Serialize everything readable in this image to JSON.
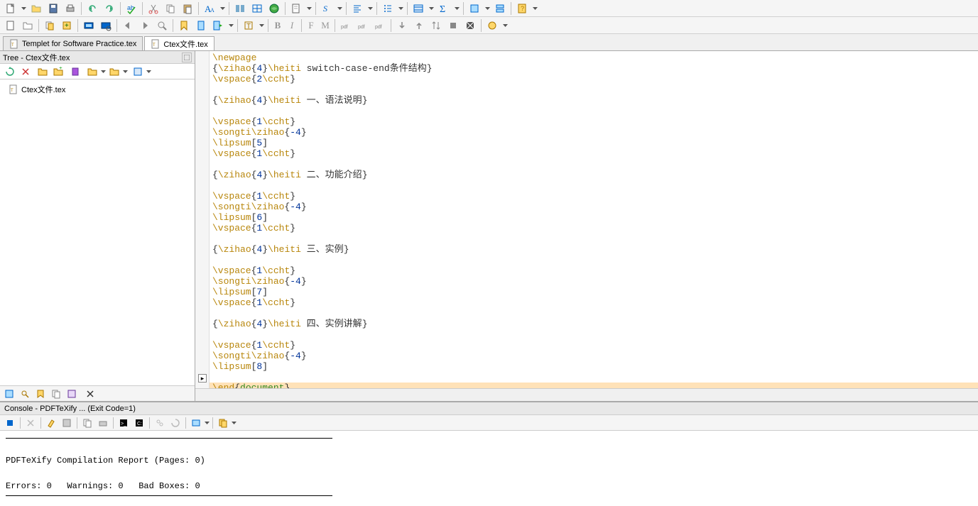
{
  "doctabs": [
    {
      "label": "Templet for Software Practice.tex",
      "active": false
    },
    {
      "label": "Ctex文件.tex",
      "active": true
    }
  ],
  "tree": {
    "title": "Tree - Ctex文件.tex",
    "items": [
      {
        "label": "Ctex文件.tex"
      }
    ]
  },
  "editor": {
    "highlighted_index": 31,
    "lines": [
      {
        "tokens": [
          [
            "cmd",
            "\\newpage"
          ]
        ]
      },
      {
        "tokens": [
          [
            "brace",
            "{"
          ],
          [
            "cmd",
            "\\zihao"
          ],
          [
            "brace",
            "{"
          ],
          [
            "num",
            "4"
          ],
          [
            "brace",
            "}"
          ],
          [
            "cmd",
            "\\heiti"
          ],
          [
            "txt",
            " switch-case-end条件结构"
          ],
          [
            "brace",
            "}"
          ]
        ]
      },
      {
        "tokens": [
          [
            "cmd",
            "\\vspace"
          ],
          [
            "brace",
            "{"
          ],
          [
            "num",
            "2"
          ],
          [
            "cmd",
            "\\ccht"
          ],
          [
            "brace",
            "}"
          ]
        ]
      },
      {
        "tokens": []
      },
      {
        "tokens": [
          [
            "brace",
            "{"
          ],
          [
            "cmd",
            "\\zihao"
          ],
          [
            "brace",
            "{"
          ],
          [
            "num",
            "4"
          ],
          [
            "brace",
            "}"
          ],
          [
            "cmd",
            "\\heiti"
          ],
          [
            "txt",
            " 一、语法说明"
          ],
          [
            "brace",
            "}"
          ]
        ]
      },
      {
        "tokens": []
      },
      {
        "tokens": [
          [
            "cmd",
            "\\vspace"
          ],
          [
            "brace",
            "{"
          ],
          [
            "num",
            "1"
          ],
          [
            "cmd",
            "\\ccht"
          ],
          [
            "brace",
            "}"
          ]
        ]
      },
      {
        "tokens": [
          [
            "cmd",
            "\\songti"
          ],
          [
            "cmd",
            "\\zihao"
          ],
          [
            "brace",
            "{"
          ],
          [
            "num",
            "-4"
          ],
          [
            "brace",
            "}"
          ]
        ]
      },
      {
        "tokens": [
          [
            "cmd",
            "\\lipsum"
          ],
          [
            "brace",
            "["
          ],
          [
            "num",
            "5"
          ],
          [
            "brace",
            "]"
          ]
        ]
      },
      {
        "tokens": [
          [
            "cmd",
            "\\vspace"
          ],
          [
            "brace",
            "{"
          ],
          [
            "num",
            "1"
          ],
          [
            "cmd",
            "\\ccht"
          ],
          [
            "brace",
            "}"
          ]
        ]
      },
      {
        "tokens": []
      },
      {
        "tokens": [
          [
            "brace",
            "{"
          ],
          [
            "cmd",
            "\\zihao"
          ],
          [
            "brace",
            "{"
          ],
          [
            "num",
            "4"
          ],
          [
            "brace",
            "}"
          ],
          [
            "cmd",
            "\\heiti"
          ],
          [
            "txt",
            " 二、功能介绍"
          ],
          [
            "brace",
            "}"
          ]
        ]
      },
      {
        "tokens": []
      },
      {
        "tokens": [
          [
            "cmd",
            "\\vspace"
          ],
          [
            "brace",
            "{"
          ],
          [
            "num",
            "1"
          ],
          [
            "cmd",
            "\\ccht"
          ],
          [
            "brace",
            "}"
          ]
        ]
      },
      {
        "tokens": [
          [
            "cmd",
            "\\songti"
          ],
          [
            "cmd",
            "\\zihao"
          ],
          [
            "brace",
            "{"
          ],
          [
            "num",
            "-4"
          ],
          [
            "brace",
            "}"
          ]
        ]
      },
      {
        "tokens": [
          [
            "cmd",
            "\\lipsum"
          ],
          [
            "brace",
            "["
          ],
          [
            "num",
            "6"
          ],
          [
            "brace",
            "]"
          ]
        ]
      },
      {
        "tokens": [
          [
            "cmd",
            "\\vspace"
          ],
          [
            "brace",
            "{"
          ],
          [
            "num",
            "1"
          ],
          [
            "cmd",
            "\\ccht"
          ],
          [
            "brace",
            "}"
          ]
        ]
      },
      {
        "tokens": []
      },
      {
        "tokens": [
          [
            "brace",
            "{"
          ],
          [
            "cmd",
            "\\zihao"
          ],
          [
            "brace",
            "{"
          ],
          [
            "num",
            "4"
          ],
          [
            "brace",
            "}"
          ],
          [
            "cmd",
            "\\heiti"
          ],
          [
            "txt",
            " 三、实例"
          ],
          [
            "brace",
            "}"
          ]
        ]
      },
      {
        "tokens": []
      },
      {
        "tokens": [
          [
            "cmd",
            "\\vspace"
          ],
          [
            "brace",
            "{"
          ],
          [
            "num",
            "1"
          ],
          [
            "cmd",
            "\\ccht"
          ],
          [
            "brace",
            "}"
          ]
        ]
      },
      {
        "tokens": [
          [
            "cmd",
            "\\songti"
          ],
          [
            "cmd",
            "\\zihao"
          ],
          [
            "brace",
            "{"
          ],
          [
            "num",
            "-4"
          ],
          [
            "brace",
            "}"
          ]
        ]
      },
      {
        "tokens": [
          [
            "cmd",
            "\\lipsum"
          ],
          [
            "brace",
            "["
          ],
          [
            "num",
            "7"
          ],
          [
            "brace",
            "]"
          ]
        ]
      },
      {
        "tokens": [
          [
            "cmd",
            "\\vspace"
          ],
          [
            "brace",
            "{"
          ],
          [
            "num",
            "1"
          ],
          [
            "cmd",
            "\\ccht"
          ],
          [
            "brace",
            "}"
          ]
        ]
      },
      {
        "tokens": []
      },
      {
        "tokens": [
          [
            "brace",
            "{"
          ],
          [
            "cmd",
            "\\zihao"
          ],
          [
            "brace",
            "{"
          ],
          [
            "num",
            "4"
          ],
          [
            "brace",
            "}"
          ],
          [
            "cmd",
            "\\heiti"
          ],
          [
            "txt",
            " 四、实例讲解"
          ],
          [
            "brace",
            "}"
          ]
        ]
      },
      {
        "tokens": []
      },
      {
        "tokens": [
          [
            "cmd",
            "\\vspace"
          ],
          [
            "brace",
            "{"
          ],
          [
            "num",
            "1"
          ],
          [
            "cmd",
            "\\ccht"
          ],
          [
            "brace",
            "}"
          ]
        ]
      },
      {
        "tokens": [
          [
            "cmd",
            "\\songti"
          ],
          [
            "cmd",
            "\\zihao"
          ],
          [
            "brace",
            "{"
          ],
          [
            "num",
            "-4"
          ],
          [
            "brace",
            "}"
          ]
        ]
      },
      {
        "tokens": [
          [
            "cmd",
            "\\lipsum"
          ],
          [
            "brace",
            "["
          ],
          [
            "num",
            "8"
          ],
          [
            "brace",
            "]"
          ]
        ]
      },
      {
        "tokens": []
      },
      {
        "tokens": [
          [
            "cmd",
            "\\end"
          ],
          [
            "brace",
            "{"
          ],
          [
            "doc",
            "document"
          ],
          [
            "brace",
            "}"
          ]
        ]
      }
    ]
  },
  "console": {
    "title": "Console - PDFTeXify ... (Exit Code=1)",
    "report_line": "PDFTeXify Compilation Report (Pages: 0)",
    "summary_line": "Errors: 0   Warnings: 0   Bad Boxes: 0"
  }
}
